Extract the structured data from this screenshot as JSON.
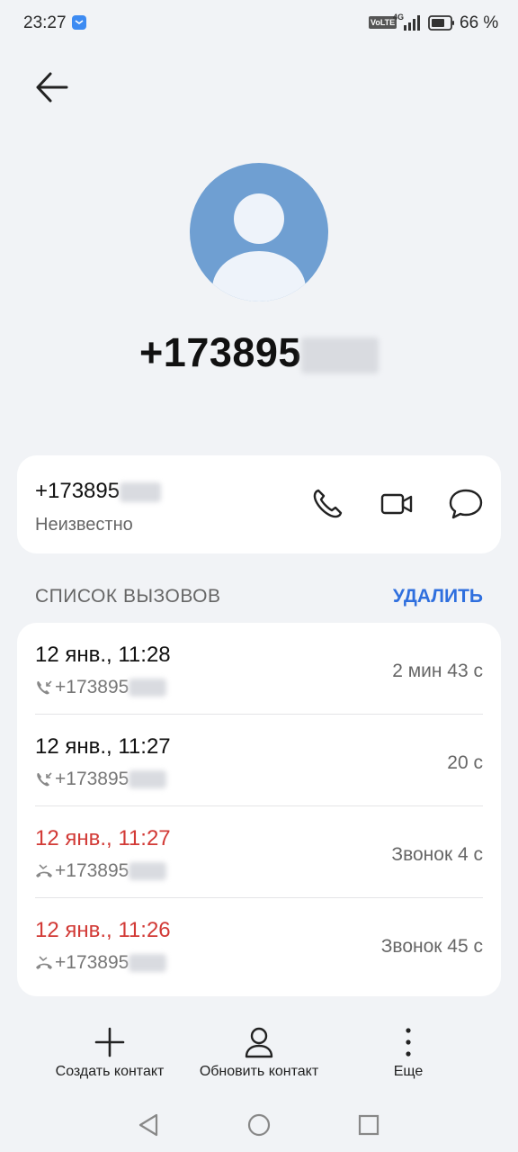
{
  "status_bar": {
    "time": "23:27",
    "volte": "VoLTE",
    "network": "4G",
    "battery": "66 %"
  },
  "contact": {
    "number_prefix": "+173895",
    "card_number_prefix": "+173895",
    "status": "Неизвестно"
  },
  "calls_section": {
    "title": "СПИСОК ВЫЗОВОВ",
    "delete_label": "УДАЛИТЬ"
  },
  "calls": [
    {
      "date": "12 янв., 11:28",
      "number": "+173895",
      "duration": "2 мин 43 с",
      "type": "incoming"
    },
    {
      "date": "12 янв., 11:27",
      "number": "+173895",
      "duration": "20 с",
      "type": "incoming"
    },
    {
      "date": "12 янв., 11:27",
      "number": "+173895",
      "duration": "Звонок 4 с",
      "type": "missed"
    },
    {
      "date": "12 янв., 11:26",
      "number": "+173895",
      "duration": "Звонок 45 с",
      "type": "missed"
    }
  ],
  "bottom_actions": {
    "create": "Создать контакт",
    "update": "Обновить контакт",
    "more": "Еще"
  },
  "colors": {
    "accent": "#2f6fde",
    "missed": "#d23a36",
    "avatar": "#6f9fd2",
    "background": "#f1f3f6"
  }
}
